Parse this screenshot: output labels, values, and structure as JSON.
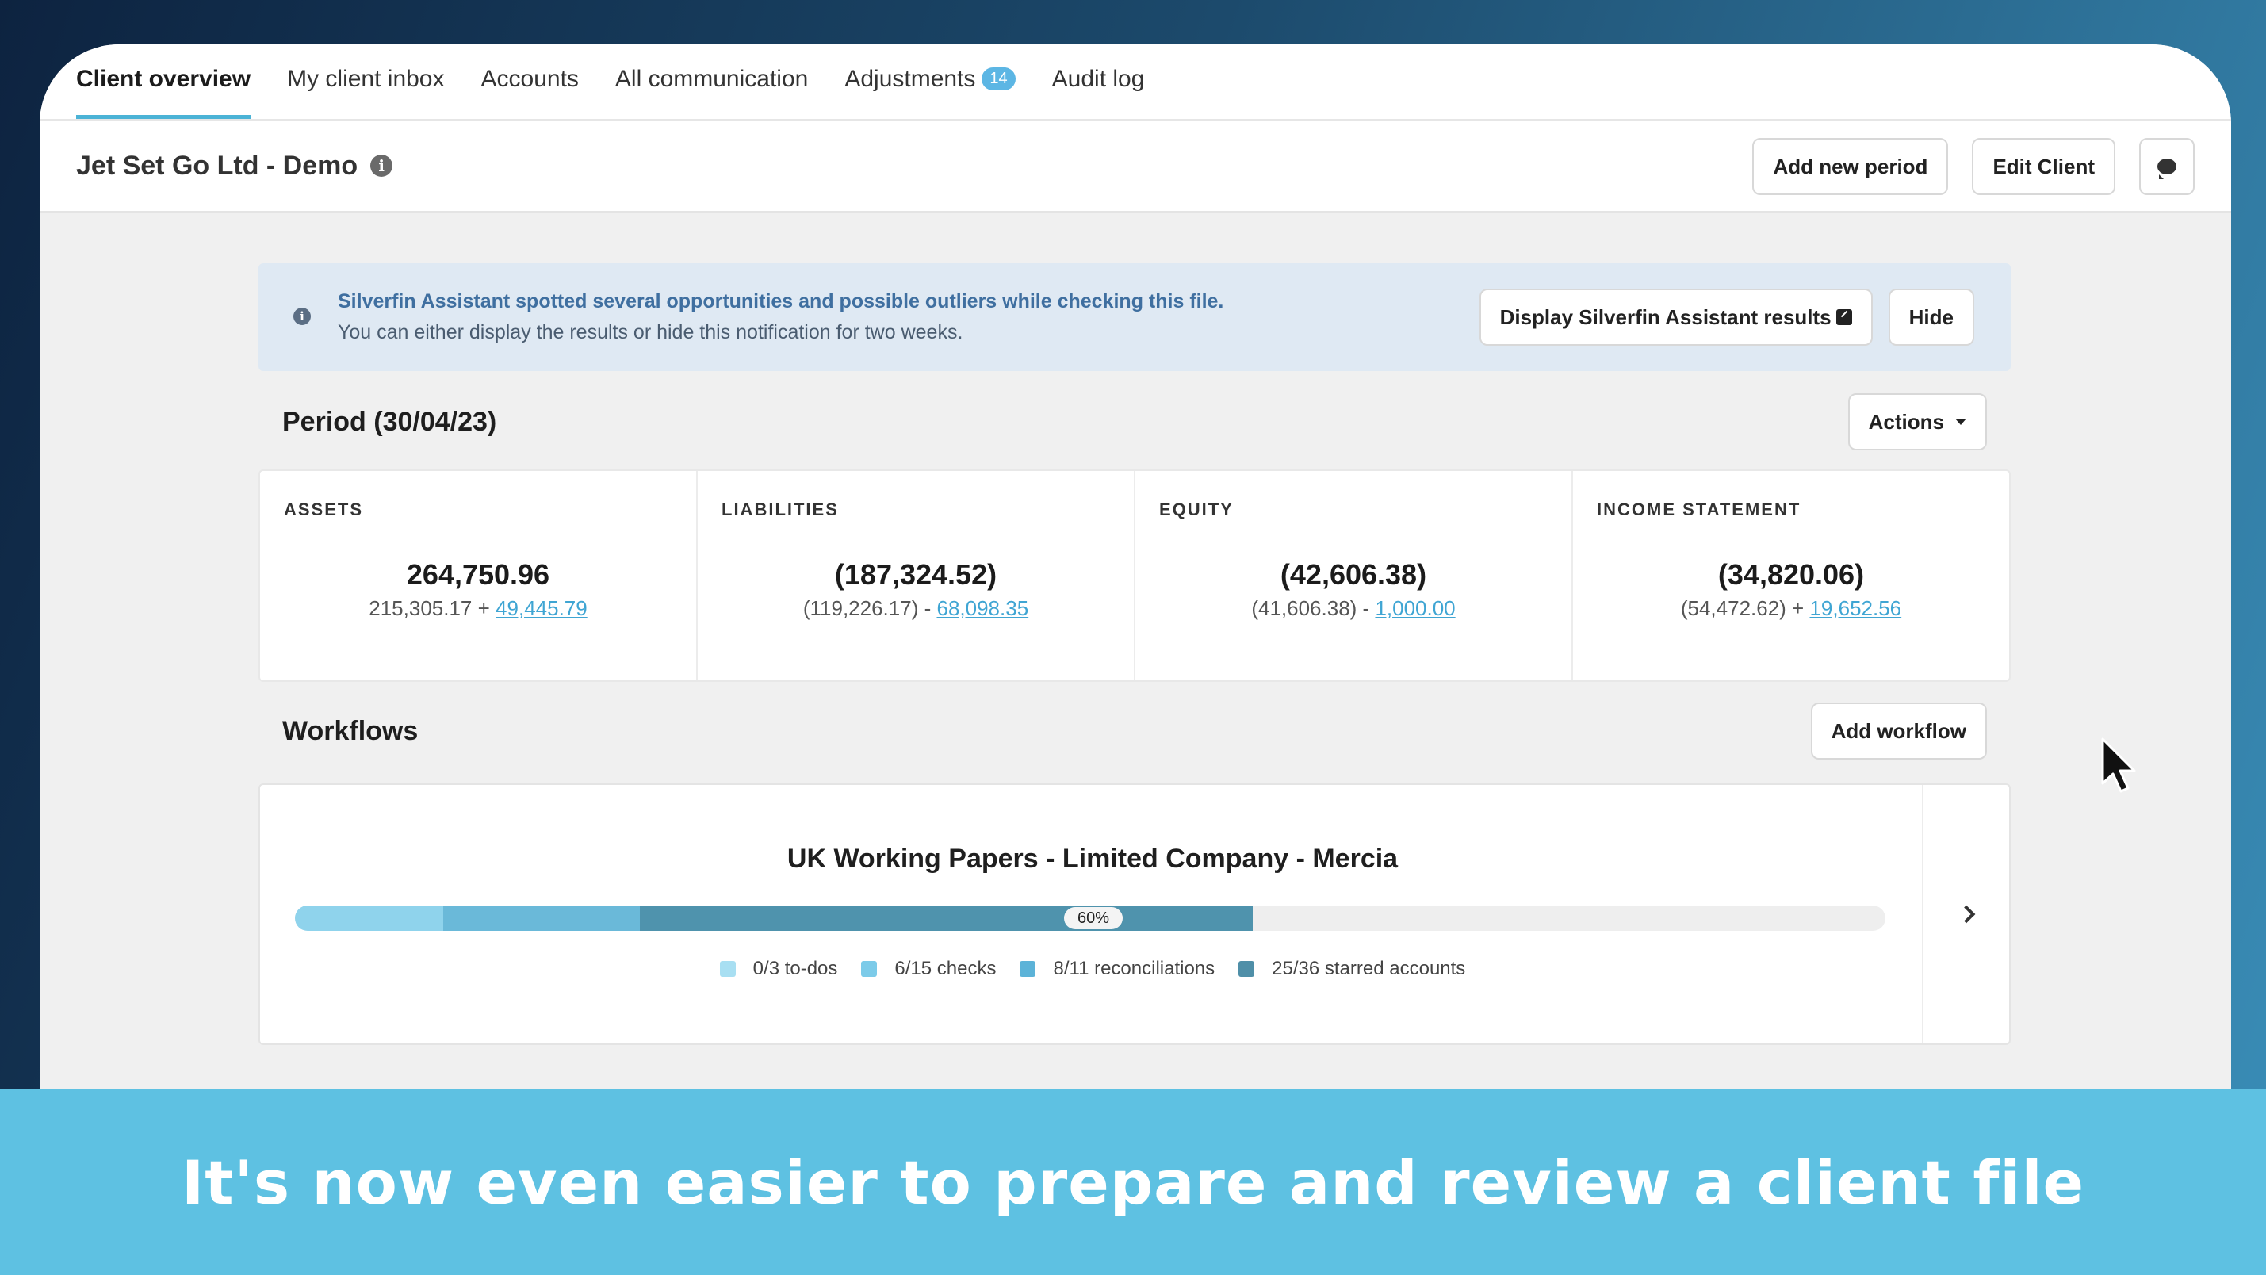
{
  "nav": {
    "tabs": [
      {
        "label": "Client overview"
      },
      {
        "label": "My client inbox"
      },
      {
        "label": "Accounts"
      },
      {
        "label": "All communication"
      },
      {
        "label": "Adjustments",
        "badge": "14"
      },
      {
        "label": "Audit log"
      }
    ]
  },
  "client": {
    "name": "Jet Set Go Ltd - Demo",
    "add_period_label": "Add new period",
    "edit_client_label": "Edit Client"
  },
  "notice": {
    "title": "Silverfin Assistant spotted several opportunities and possible outliers while checking this file.",
    "body": "You can either display the results or hide this notification for two weeks.",
    "display_label": "Display Silverfin Assistant results",
    "hide_label": "Hide"
  },
  "period": {
    "title": "Period (30/04/23)",
    "actions_label": "Actions"
  },
  "stats": [
    {
      "label": "ASSETS",
      "value": "264,750.96",
      "base": "215,305.17 +",
      "delta": "49,445.79"
    },
    {
      "label": "LIABILITIES",
      "value": "(187,324.52)",
      "base": "(119,226.17) -",
      "delta": "68,098.35"
    },
    {
      "label": "EQUITY",
      "value": "(42,606.38)",
      "base": "(41,606.38) -",
      "delta": "1,000.00"
    },
    {
      "label": "INCOME STATEMENT",
      "value": "(34,820.06)",
      "base": "(54,472.62) +",
      "delta": "19,652.56"
    }
  ],
  "workflows": {
    "title": "Workflows",
    "add_label": "Add workflow",
    "card": {
      "name": "UK Working Papers - Limited Company - Mercia",
      "progress_label": "60%",
      "progress": 0.6,
      "segments": [
        {
          "fraction": 0.093,
          "color": "#8fd3ec"
        },
        {
          "fraction": 0.124,
          "color": "#6ab9d9"
        },
        {
          "fraction": 0.385,
          "color": "#4f93ad"
        }
      ],
      "legend": [
        {
          "label": "0/3 to-dos",
          "color": "#a8dff2"
        },
        {
          "label": "6/15 checks",
          "color": "#7ccbe9"
        },
        {
          "label": "8/11 reconciliations",
          "color": "#5cb3d8"
        },
        {
          "label": "25/36 starred accounts",
          "color": "#4f8fa8"
        }
      ]
    }
  },
  "caption": "It's now even easier to prepare and review a client file"
}
